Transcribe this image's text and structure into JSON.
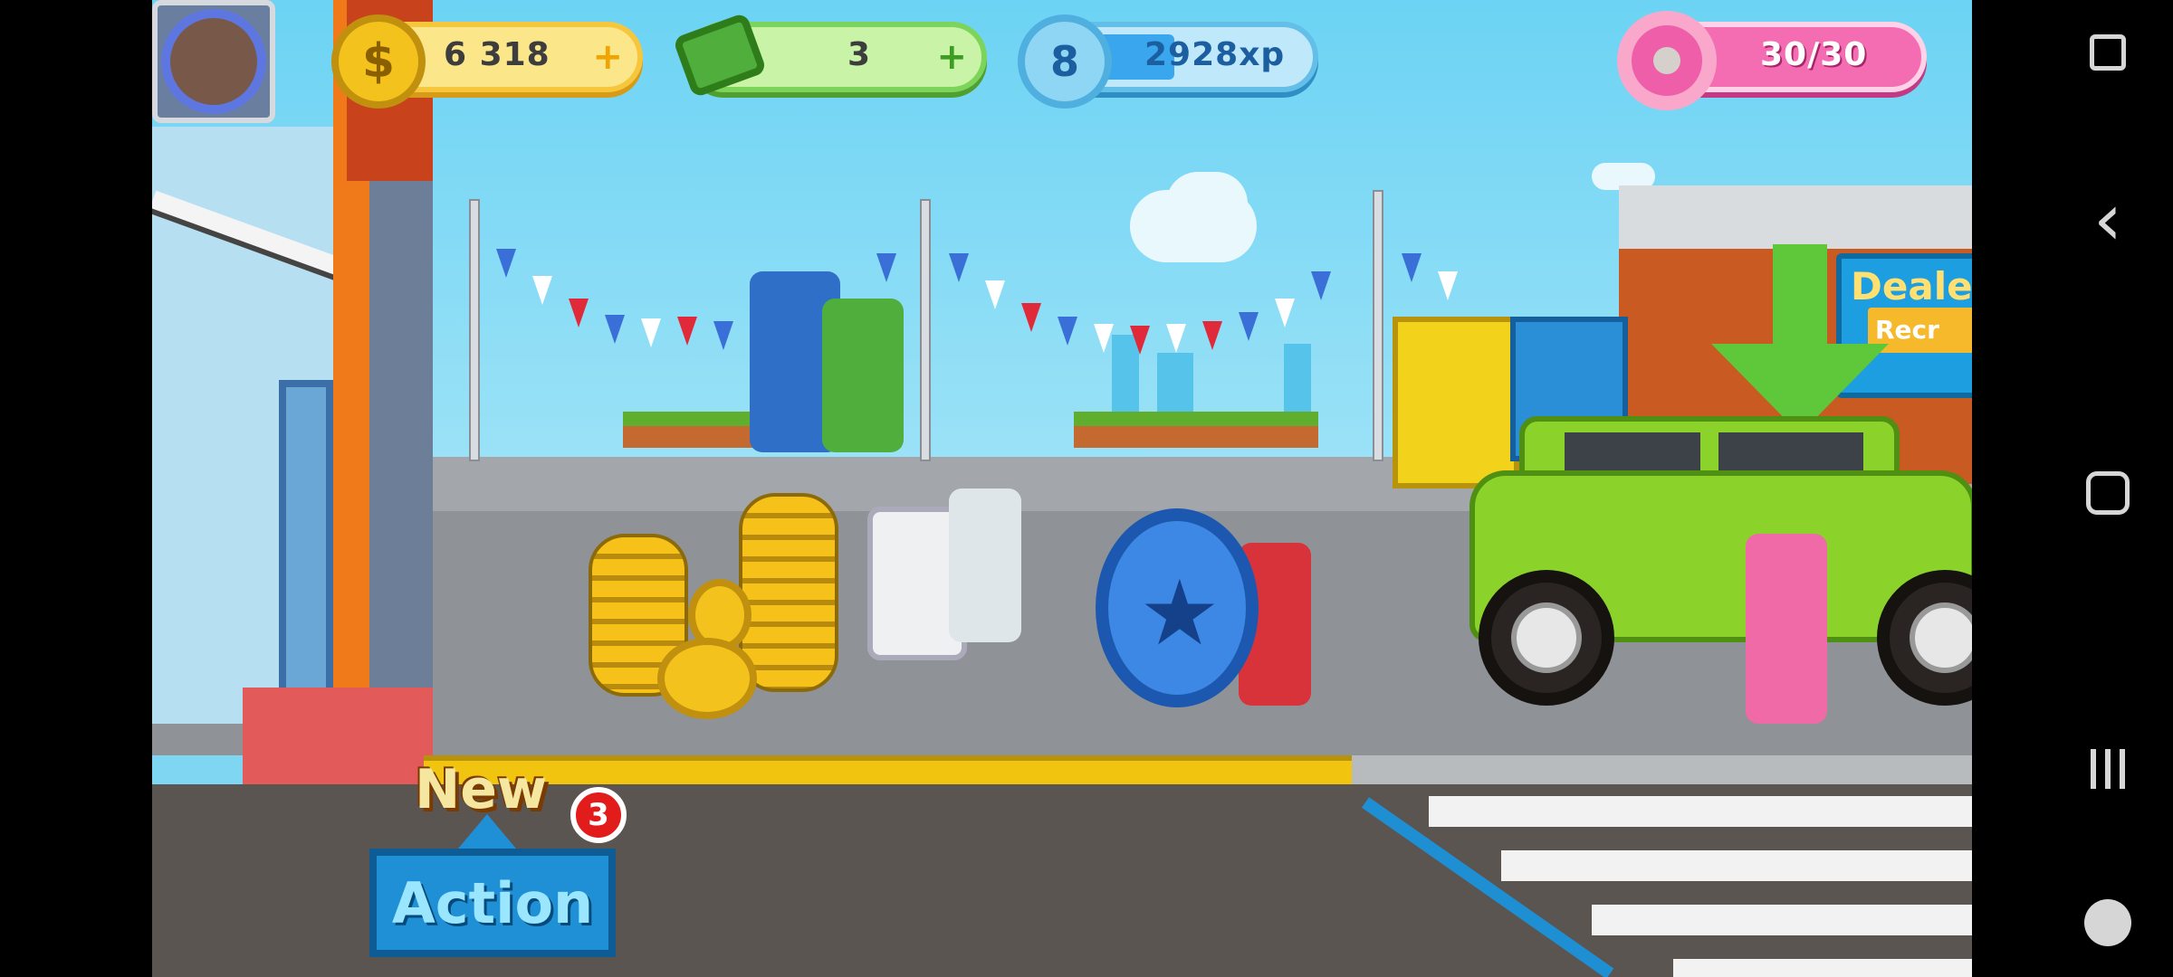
{
  "hud": {
    "coins": {
      "value": "6 318",
      "plus": "+",
      "icon": "dollar-coin-icon",
      "symbol": "$"
    },
    "cash": {
      "value": "3",
      "plus": "+",
      "icon": "cash-stack-icon"
    },
    "xp": {
      "level": "8",
      "value": "2928xp",
      "icon": "xp-badge-icon",
      "progress": 0.35
    },
    "energy": {
      "value": "30/30",
      "icon": "donut-icon"
    }
  },
  "scene": {
    "dealer_sign": "Deale",
    "dealer_sub": "Recr",
    "star_symbol": "★"
  },
  "buttons": {
    "new_label": "New",
    "new_badge_count": "3",
    "action_label": "Action",
    "wrench_symbol": "🔧",
    "alert_symbol": "!"
  },
  "navbar": {
    "back_symbol": "‹",
    "items": [
      "game-tools-icon",
      "back-icon",
      "home-icon",
      "recents-icon",
      "game-launcher-icon"
    ]
  },
  "colors": {
    "coin": "#f4c21c",
    "cash": "#6cc84a",
    "xp": "#3aa6ee",
    "energy": "#f46db3",
    "action": "#1f8fd6"
  }
}
